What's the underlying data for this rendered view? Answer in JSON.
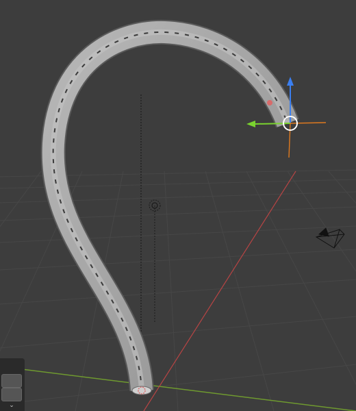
{
  "app": "3D viewport",
  "colors": {
    "background": "#3d3d3d",
    "grid_line": "#4a4a4a",
    "x_axis": "#b84444",
    "y_axis": "#6f9a2f",
    "gizmo_x": "#e07a1f",
    "gizmo_y": "#7ad32f",
    "gizmo_z": "#3b7ff0",
    "curve_fill": "#a6a6a6"
  },
  "icons": {
    "origin": "origin-marker-icon",
    "camera": "camera-object-icon",
    "gizmo": "transform-gizmo-icon"
  },
  "side_panel": {
    "chevron": "⌄"
  }
}
